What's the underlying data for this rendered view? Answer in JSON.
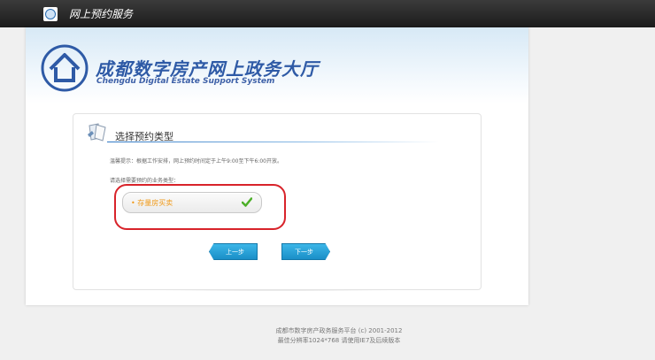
{
  "topbar": {
    "title": "网上预约服务"
  },
  "header": {
    "title_cn": "成都数字房产网上政务大厅",
    "title_en": "Chengdu Digital Estate Support System"
  },
  "card": {
    "title": "选择预约类型",
    "notice": "温馨提示：根据工作安排，网上预约时间定于上午9:00至下午6:00开放。",
    "prompt": "请选择需要预约的业务类型：",
    "options": [
      {
        "label": "• 存量房买卖",
        "selected": true
      }
    ],
    "prev_label": "上一步",
    "next_label": "下一步"
  },
  "footer": {
    "line1": "成都市数字房产政务服务平台 (c) 2001-2012",
    "line2": "最佳分辨率1024*768  请使用IE7及后续版本"
  },
  "colors": {
    "accent": "#2e5aa6",
    "option_text": "#f09a1a",
    "highlight": "#d8232a",
    "button": "#1a8fc7"
  }
}
